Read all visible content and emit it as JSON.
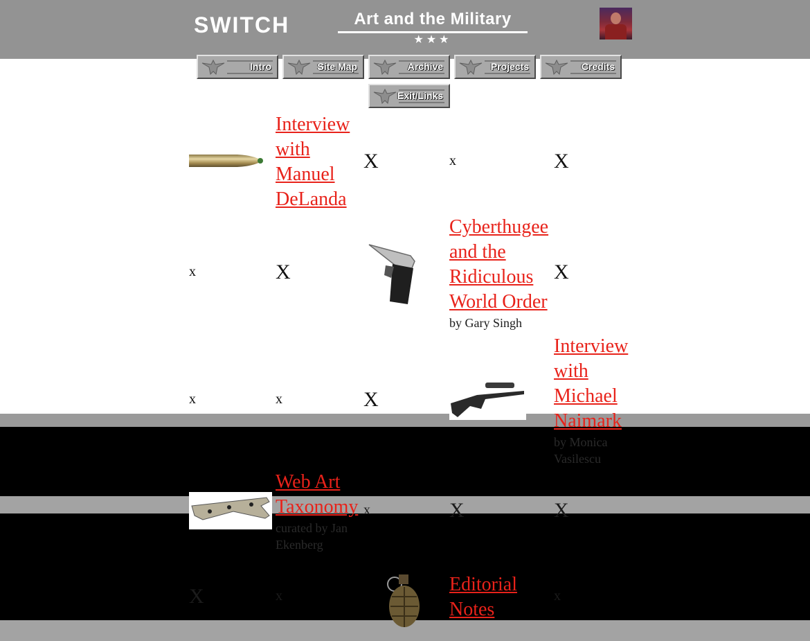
{
  "header": {
    "logo": "SWITCH",
    "title": "Art and the Military",
    "stars": "★★★",
    "avatar_icon": "soldier-portrait-icon"
  },
  "nav": {
    "buttons": [
      "Intro",
      "Site Map",
      "Archive",
      "Projects",
      "Credits",
      "Exit/Links"
    ]
  },
  "colors": {
    "header_bg": "#939393",
    "link": "#e8221a",
    "page_bg": "#ffffff"
  },
  "grid": {
    "row1": {
      "image": "bullet-image",
      "link": "Interview with Manuel DeLanda",
      "marks": [
        "X",
        "x",
        "X"
      ]
    },
    "row2": {
      "marks": [
        "x",
        "X",
        "X"
      ],
      "image": "pistol-image",
      "link": "Cyberthugee and the Ridiculous World Order",
      "byline": "by Gary Singh"
    },
    "row3": {
      "marks": [
        "x",
        "x",
        "X"
      ],
      "image": "rifle-image",
      "link": "Interview with Michael Naimark",
      "byline": "by Monica Vasilescu"
    },
    "row4": {
      "image": "fighter-plane-image",
      "link": "Web Art Taxonomy",
      "byline": "curated by Jan Ekenberg",
      "marks": [
        "x",
        "X",
        "X"
      ]
    },
    "row5": {
      "marks": [
        "X",
        "x",
        "x"
      ],
      "image": "grenade-image",
      "link": "Editorial Notes"
    }
  }
}
